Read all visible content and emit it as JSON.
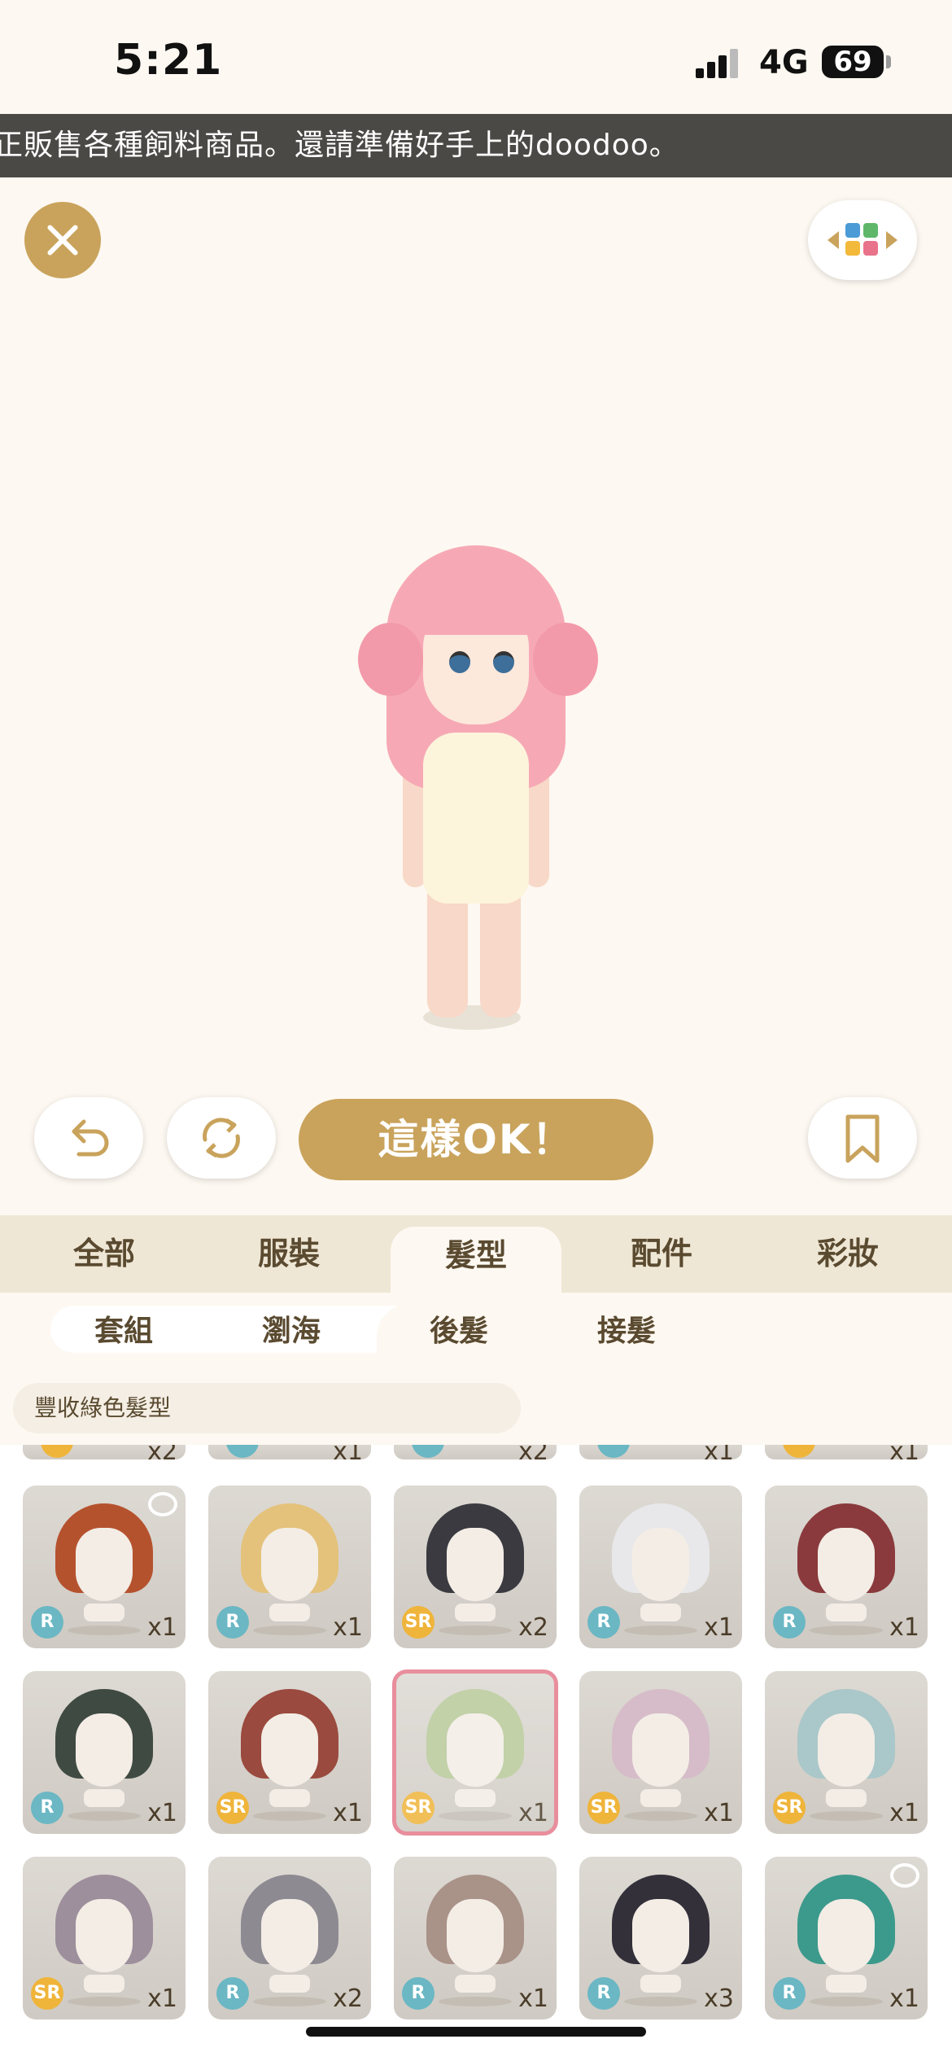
{
  "status": {
    "time": "5:21",
    "network": "4G",
    "battery": "69"
  },
  "ticker": "正販售各種飼料商品。還請準備好手上的doodoo。",
  "actions": {
    "ok_label": "這樣OK！"
  },
  "tabs": [
    "全部",
    "服裝",
    "髮型",
    "配件",
    "彩妝"
  ],
  "active_tab": "髮型",
  "subtabs": [
    "套組",
    "瀏海",
    "後髮",
    "接髮"
  ],
  "active_subtab": "後髮",
  "filter_label": "豐收綠色髮型",
  "partial_row_counts": [
    "x2",
    "x1",
    "x2",
    "x1",
    "x1"
  ],
  "partial_row_rarity_colors": [
    "#efb43a",
    "#6bb7c4",
    "#6bb7c4",
    "#6bb7c4",
    "#efb43a"
  ],
  "items": [
    {
      "rarity": "R",
      "count": "x1",
      "color": "#b5522e",
      "bear": true
    },
    {
      "rarity": "R",
      "count": "x1",
      "color": "#e4c27b",
      "bear": false
    },
    {
      "rarity": "SR",
      "count": "x2",
      "color": "#3a3a40",
      "bear": false
    },
    {
      "rarity": "R",
      "count": "x1",
      "color": "#e8e8ea",
      "bear": false
    },
    {
      "rarity": "R",
      "count": "x1",
      "color": "#8a3a3c",
      "bear": false
    },
    {
      "rarity": "R",
      "count": "x1",
      "color": "#3f4a42",
      "bear": false
    },
    {
      "rarity": "SR",
      "count": "x1",
      "color": "#9a4a3e",
      "bear": false
    },
    {
      "rarity": "SR",
      "count": "x1",
      "color": "#b8c99a",
      "bear": false,
      "selected": true
    },
    {
      "rarity": "SR",
      "count": "x1",
      "color": "#d6bcc8",
      "bear": false
    },
    {
      "rarity": "SR",
      "count": "x1",
      "color": "#aac7c9",
      "bear": false
    },
    {
      "rarity": "SR",
      "count": "x1",
      "color": "#9e8f9c",
      "bear": false
    },
    {
      "rarity": "R",
      "count": "x2",
      "color": "#8e8a92",
      "bear": false
    },
    {
      "rarity": "R",
      "count": "x1",
      "color": "#a99288",
      "bear": false
    },
    {
      "rarity": "R",
      "count": "x3",
      "color": "#33303a",
      "bear": false
    },
    {
      "rarity": "R",
      "count": "x1",
      "color": "#3c9a8c",
      "bear": true
    }
  ]
}
